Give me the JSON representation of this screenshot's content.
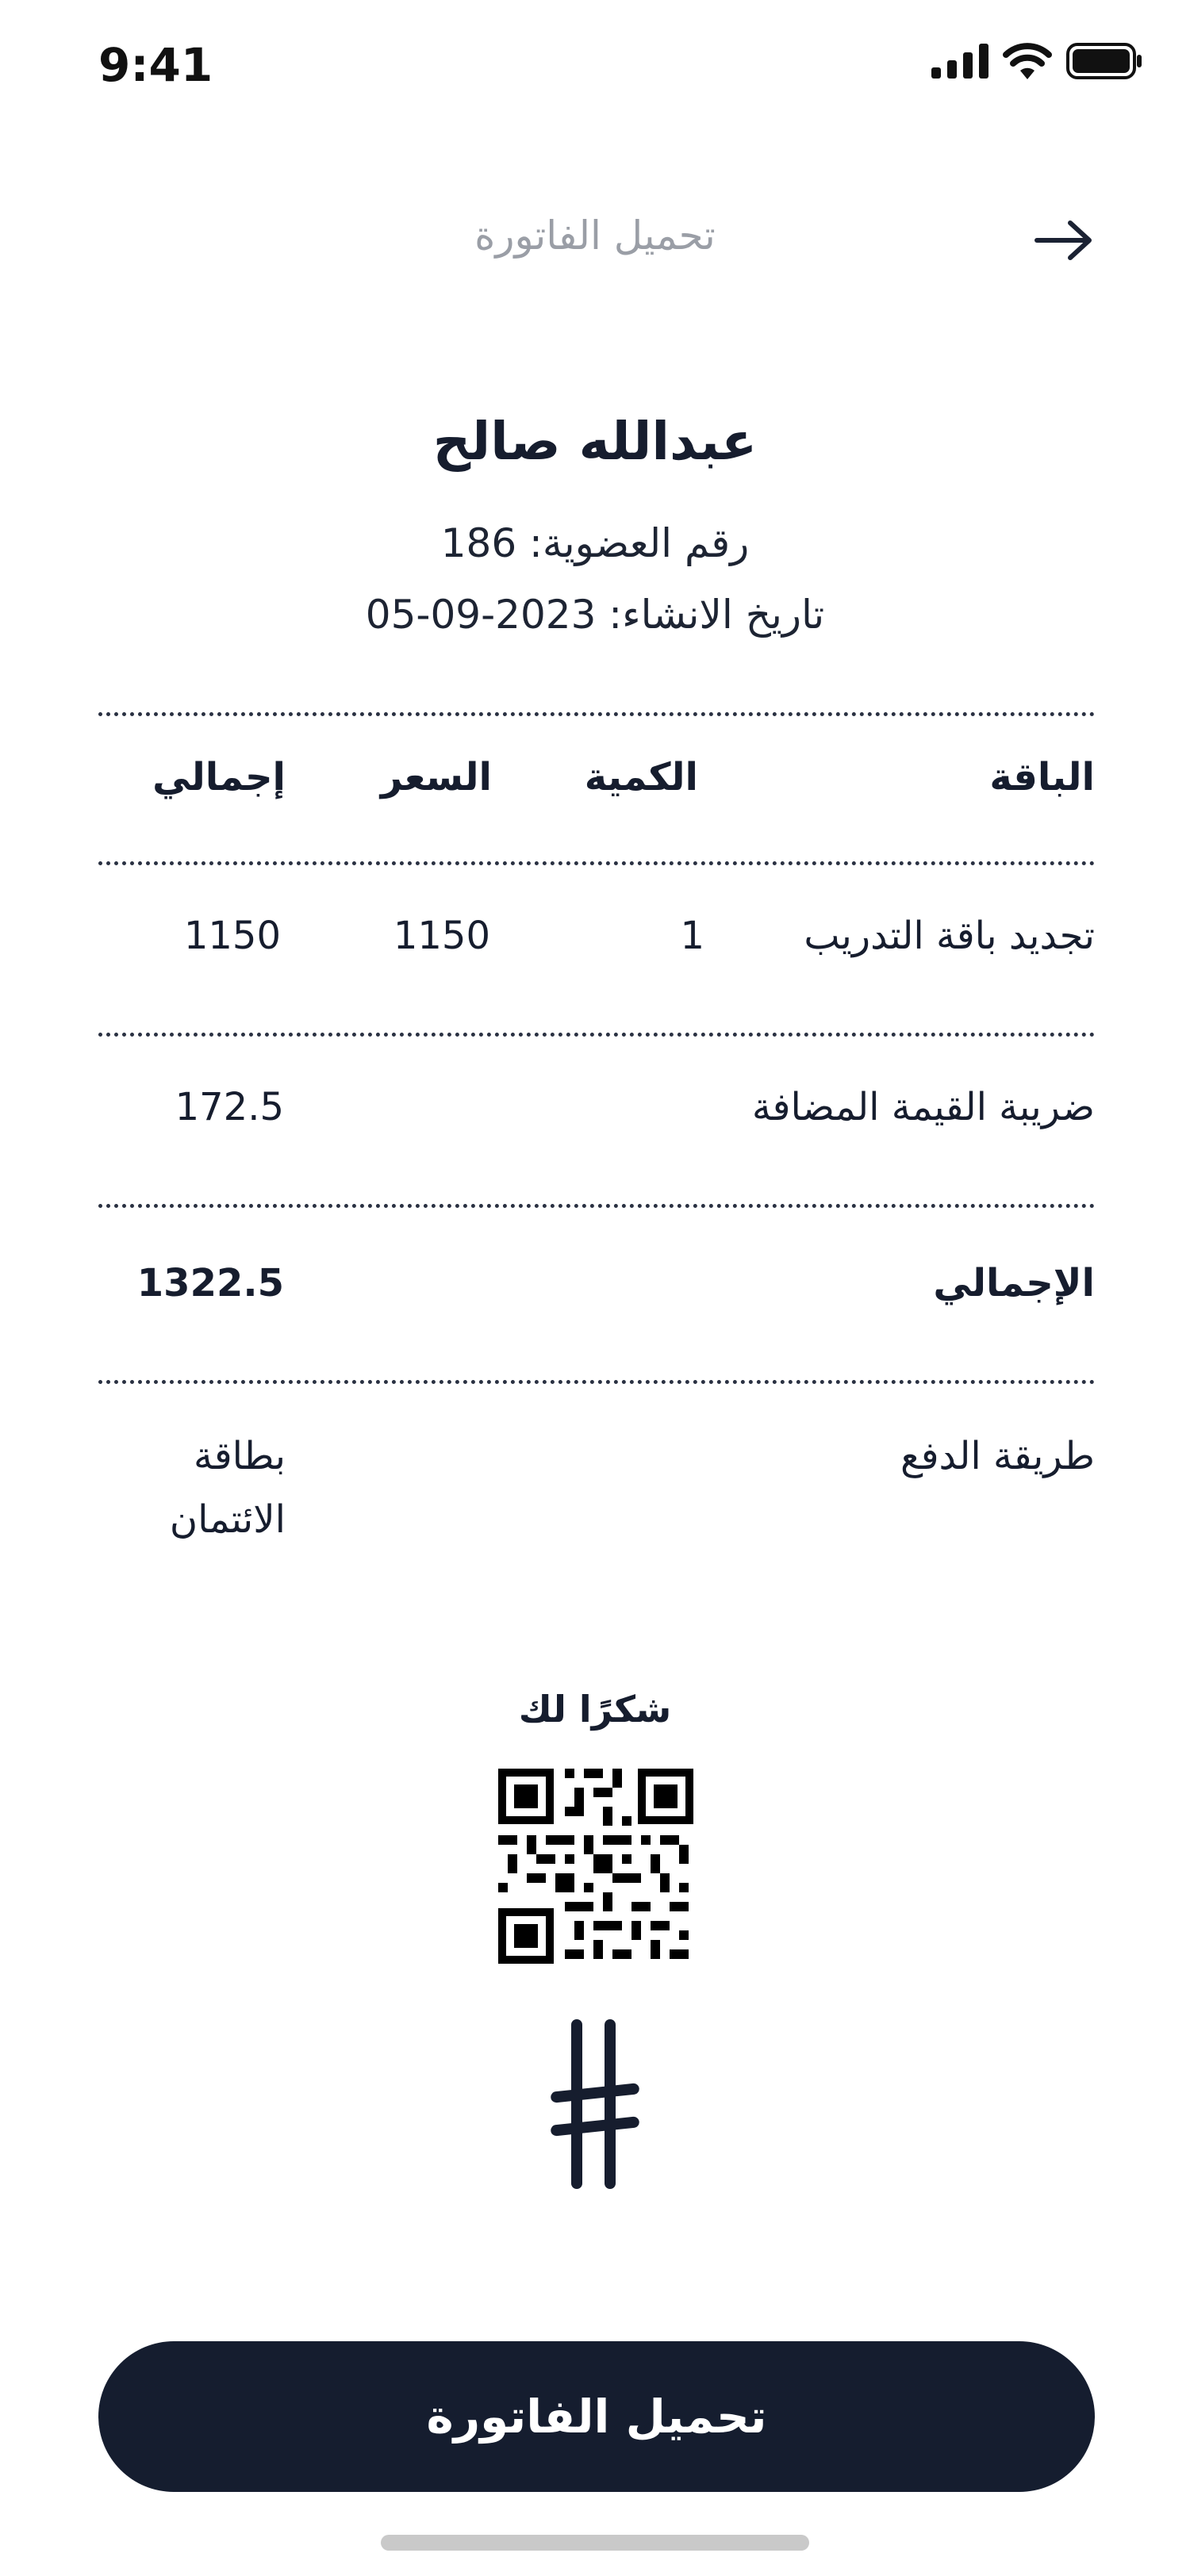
{
  "status_bar": {
    "time": "9:41"
  },
  "header": {
    "title": "تحميل الفاتورة",
    "back_icon": "arrow-right-icon"
  },
  "customer": {
    "name": "عبدالله صالح",
    "membership": "رقم العضوية: 186",
    "created": "تاريخ الانشاء: 2023-09-05"
  },
  "table": {
    "headers": {
      "package": "الباقة",
      "quantity": "الكمية",
      "price": "السعر",
      "total": "إجمالي"
    },
    "rows": [
      {
        "package": "تجديد باقة التدريب",
        "quantity": "1",
        "price": "1150",
        "total": "1150"
      }
    ],
    "vat_label": "ضريبة القيمة المضافة",
    "vat_value": "172.5",
    "grand_total_label": "الإجمالي",
    "grand_total_value": "1322.5",
    "payment_label": "طريقة الدفع",
    "payment_value_line1": "بطاقة",
    "payment_value_line2": "الائتمان"
  },
  "footer": {
    "thanks": "شكرًا لك",
    "qr_icon": "qr-code-icon",
    "logo_icon": "brand-logo-icon"
  },
  "actions": {
    "download_label": "تحميل الفاتورة"
  },
  "colors": {
    "primary": "#151d2f",
    "muted": "#9a9ea6",
    "background": "#ffffff"
  }
}
